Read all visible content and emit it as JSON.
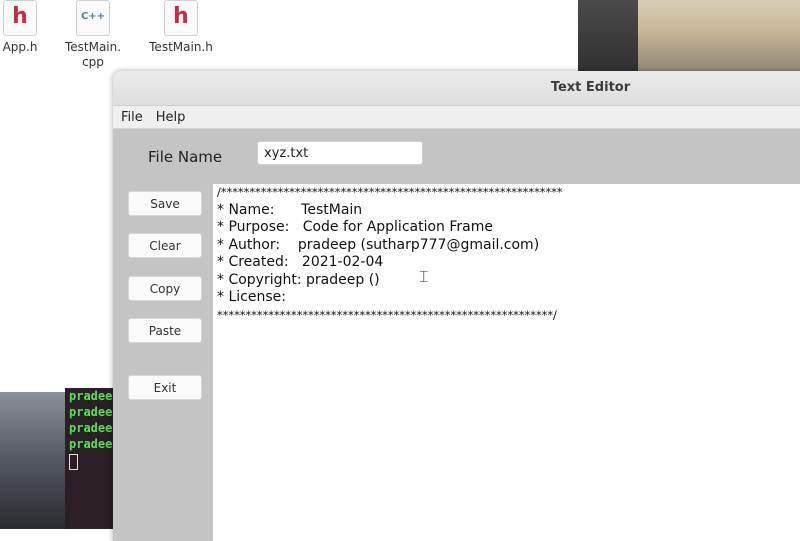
{
  "desktop": {
    "icons": [
      {
        "label": "App.h",
        "glyph": "h",
        "type": "header"
      },
      {
        "label": "TestMain.\ncpp",
        "glyph": "C++",
        "type": "cpp"
      },
      {
        "label": "TestMain.h",
        "glyph": "h",
        "type": "header"
      }
    ],
    "terminal_lines": [
      "pradeep",
      "pradeep",
      "pradeep",
      "pradeep"
    ]
  },
  "window": {
    "title": "Text Editor",
    "menu": [
      "File",
      "Help"
    ],
    "file_name_label": "File Name",
    "file_name_value": "xyz.txt",
    "buttons": {
      "save": "Save",
      "clear": "Clear",
      "copy": "Copy",
      "paste": "Paste",
      "exit": "Exit"
    },
    "editor_lines": [
      "/************************************************************",
      "* Name:      TestMain",
      "* Purpose:   Code for Application Frame",
      "* Author:    pradeep (sutharp777@gmail.com)",
      "* Created:   2021-02-04",
      "* Copyright: pradeep ()",
      "* License:",
      "***********************************************************/"
    ]
  },
  "colors": {
    "window_bg": "#c4c4c4",
    "terminal_text": "#4ee44e",
    "header_icon": "#c82b46"
  }
}
